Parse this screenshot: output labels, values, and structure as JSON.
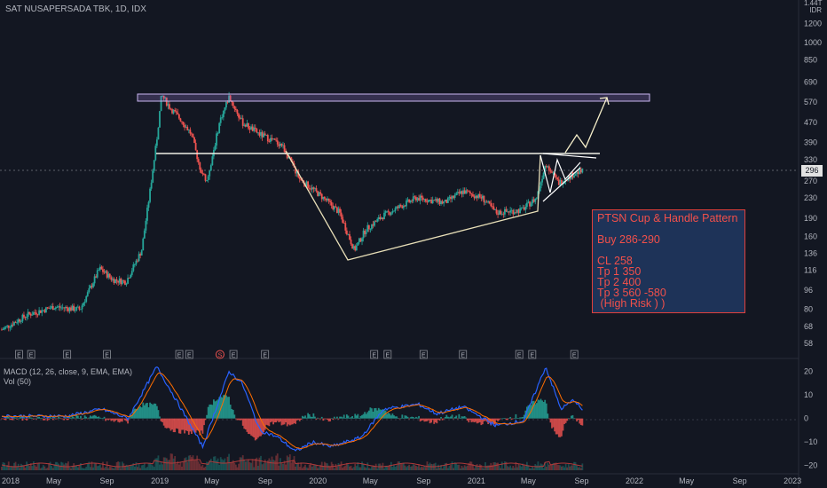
{
  "header": {
    "symbol": "SAT NUSAPERSADA TBK, 1D, IDX"
  },
  "currency": {
    "line1": "1.44T",
    "line2": "IDR"
  },
  "price_axis": {
    "ticks": [
      "1200",
      "1000",
      "850",
      "690",
      "570",
      "470",
      "390",
      "330",
      "270",
      "230",
      "190",
      "160",
      "136",
      "116",
      "96",
      "80",
      "68",
      "58"
    ]
  },
  "last_price": "296",
  "macd_axis": {
    "ticks": [
      "20",
      "10",
      "0",
      "−10",
      "−20"
    ]
  },
  "time_axis": {
    "labels": [
      "2018",
      "May",
      "Sep",
      "2019",
      "May",
      "Sep",
      "2020",
      "May",
      "Sep",
      "2021",
      "May",
      "Sep",
      "2022",
      "May",
      "Sep",
      "2023"
    ]
  },
  "indicators": {
    "macd": "MACD (12, 26, close, 9, EMA, EMA)",
    "vol": "Vol (50)"
  },
  "events": {
    "e": "E",
    "s": "S"
  },
  "annotation": {
    "title": "PTSN Cup & Handle Pattern",
    "buy": "Buy 286-290",
    "cl": "CL 258",
    "tp1": "Tp 1 350",
    "tp2": "Tp 2 400",
    "tp3": "Tp 3 560 -580",
    "risk": " (High Risk ) )"
  },
  "colors": {
    "up": "#26a69a",
    "down": "#ef5350",
    "bg": "#131722",
    "resistance_box": "#9c7ad8"
  },
  "chart_data": {
    "type": "candlestick",
    "title": "SAT NUSAPERSADA TBK, 1D, IDX",
    "y_scale": "log",
    "ylim": [
      52,
      1450
    ],
    "x_range": [
      "2017-12-28",
      "2023-01-15"
    ],
    "close_path": [
      {
        "x": "2018-01-01",
        "y": 66
      },
      {
        "x": "2018-03-01",
        "y": 76
      },
      {
        "x": "2018-05-01",
        "y": 82
      },
      {
        "x": "2018-07-01",
        "y": 80
      },
      {
        "x": "2018-08-15",
        "y": 118
      },
      {
        "x": "2018-09-15",
        "y": 106
      },
      {
        "x": "2018-10-15",
        "y": 104
      },
      {
        "x": "2018-11-20",
        "y": 140
      },
      {
        "x": "2018-12-10",
        "y": 250
      },
      {
        "x": "2018-12-25",
        "y": 400
      },
      {
        "x": "2019-01-05",
        "y": 610
      },
      {
        "x": "2019-01-25",
        "y": 540
      },
      {
        "x": "2019-02-20",
        "y": 480
      },
      {
        "x": "2019-03-15",
        "y": 420
      },
      {
        "x": "2019-04-05",
        "y": 300
      },
      {
        "x": "2019-04-20",
        "y": 270
      },
      {
        "x": "2019-05-20",
        "y": 480
      },
      {
        "x": "2019-06-10",
        "y": 600
      },
      {
        "x": "2019-07-10",
        "y": 470
      },
      {
        "x": "2019-08-20",
        "y": 420
      },
      {
        "x": "2019-10-10",
        "y": 380
      },
      {
        "x": "2019-11-20",
        "y": 275
      },
      {
        "x": "2019-12-20",
        "y": 250
      },
      {
        "x": "2020-01-20",
        "y": 225
      },
      {
        "x": "2020-02-20",
        "y": 200
      },
      {
        "x": "2020-03-25",
        "y": 140
      },
      {
        "x": "2020-04-20",
        "y": 170
      },
      {
        "x": "2020-06-01",
        "y": 195
      },
      {
        "x": "2020-08-15",
        "y": 230
      },
      {
        "x": "2020-10-20",
        "y": 220
      },
      {
        "x": "2020-12-01",
        "y": 245
      },
      {
        "x": "2021-01-15",
        "y": 230
      },
      {
        "x": "2021-02-15",
        "y": 200
      },
      {
        "x": "2021-04-15",
        "y": 205
      },
      {
        "x": "2021-05-20",
        "y": 230
      },
      {
        "x": "2021-06-10",
        "y": 320
      },
      {
        "x": "2021-07-10",
        "y": 265
      },
      {
        "x": "2021-08-15",
        "y": 290
      },
      {
        "x": "2021-09-05",
        "y": 296
      }
    ],
    "last_price": 296,
    "annotations": {
      "resistance_zone": [
        560,
        600
      ],
      "cup_rim": 340,
      "cup_low": 136,
      "handle": [
        265,
        300
      ],
      "targets": [
        350,
        400,
        580
      ]
    },
    "macd": {
      "ylim": [
        -22,
        24
      ],
      "path": [
        {
          "x": "2018-01-01",
          "y": 1
        },
        {
          "x": "2018-06-01",
          "y": 1
        },
        {
          "x": "2018-08-20",
          "y": 4
        },
        {
          "x": "2018-10-20",
          "y": 0
        },
        {
          "x": "2018-12-25",
          "y": 22
        },
        {
          "x": "2019-02-01",
          "y": 10
        },
        {
          "x": "2019-04-10",
          "y": -12
        },
        {
          "x": "2019-06-10",
          "y": 20
        },
        {
          "x": "2019-07-10",
          "y": 15
        },
        {
          "x": "2019-08-20",
          "y": -5
        },
        {
          "x": "2019-10-01",
          "y": -8
        },
        {
          "x": "2019-11-10",
          "y": -14
        },
        {
          "x": "2019-12-20",
          "y": -10
        },
        {
          "x": "2020-02-01",
          "y": -12
        },
        {
          "x": "2020-04-10",
          "y": -8
        },
        {
          "x": "2020-06-01",
          "y": 4
        },
        {
          "x": "2020-08-20",
          "y": 6
        },
        {
          "x": "2020-10-01",
          "y": 2
        },
        {
          "x": "2020-12-01",
          "y": 5
        },
        {
          "x": "2021-02-15",
          "y": -3
        },
        {
          "x": "2021-04-20",
          "y": -1
        },
        {
          "x": "2021-06-10",
          "y": 22
        },
        {
          "x": "2021-07-15",
          "y": 4
        },
        {
          "x": "2021-08-15",
          "y": 8
        },
        {
          "x": "2021-09-05",
          "y": 3
        }
      ]
    }
  }
}
